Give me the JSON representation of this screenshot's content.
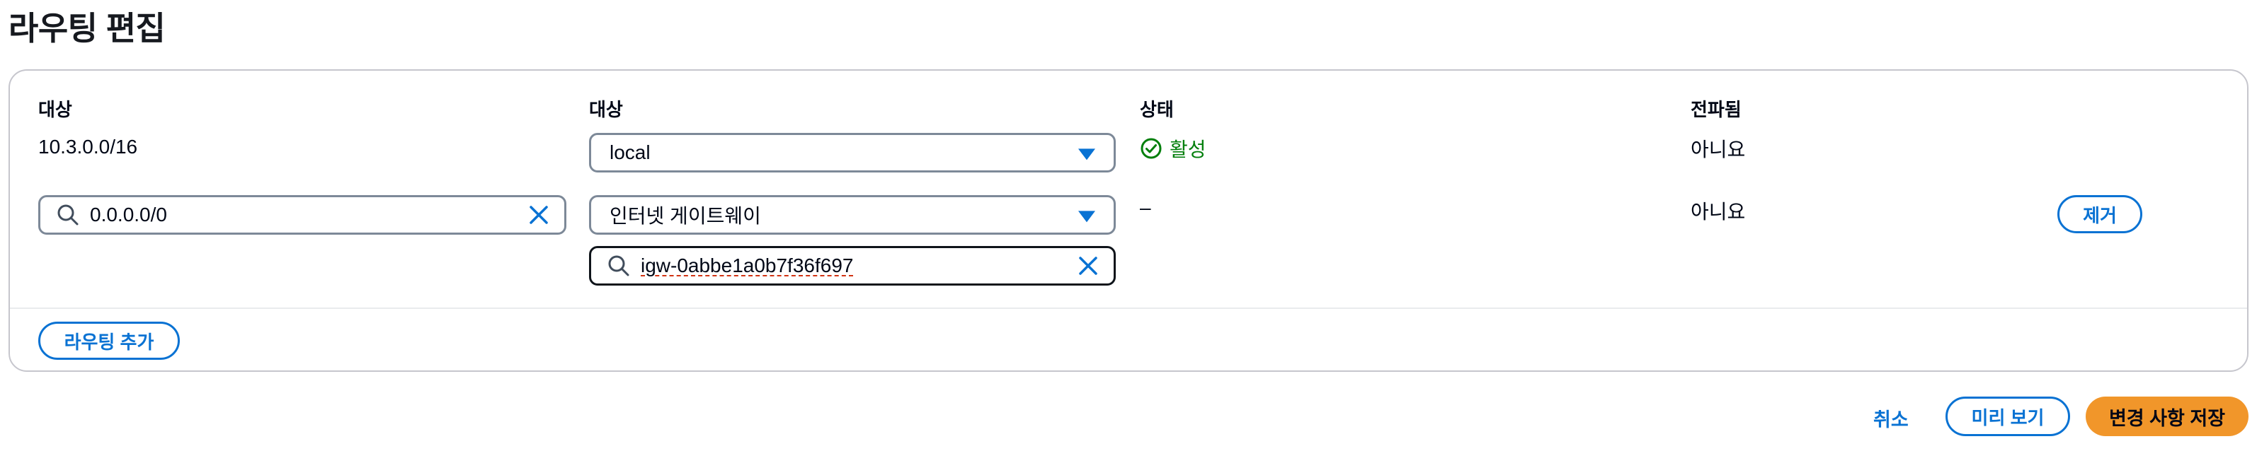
{
  "page": {
    "title": "라우팅 편집"
  },
  "table": {
    "headers": {
      "destination": "대상",
      "target": "대상",
      "status": "상태",
      "propagated": "전파됨"
    },
    "rows": [
      {
        "destination": "10.3.0.0/16",
        "target": "local",
        "status": "활성",
        "propagated": "아니요"
      },
      {
        "destination": "0.0.0.0/0",
        "target": "인터넷 게이트웨이",
        "target_id": "igw-0abbe1a0b7f36f697",
        "status": "–",
        "propagated": "아니요",
        "remove_label": "제거"
      }
    ],
    "add_route_label": "라우팅 추가"
  },
  "footer": {
    "cancel_label": "취소",
    "preview_label": "미리 보기",
    "save_label": "변경 사항 저장"
  },
  "colors": {
    "accent": "#0972d3",
    "success": "#037f0c",
    "primary_button": "#f1962a"
  }
}
